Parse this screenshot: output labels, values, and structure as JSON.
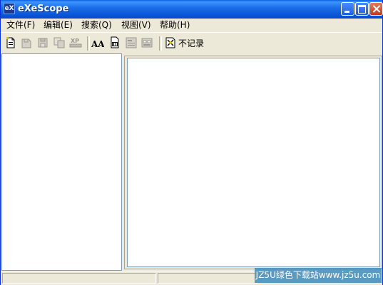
{
  "window": {
    "title": "eXeScope",
    "icon_text": "eX"
  },
  "menu": [
    {
      "label": "文件(F)"
    },
    {
      "label": "编辑(E)"
    },
    {
      "label": "搜索(Q)"
    },
    {
      "label": "视图(V)"
    },
    {
      "label": "帮助(H)"
    }
  ],
  "toolbar": {
    "no_record_label": "不记录",
    "aa_label": "AA",
    "xp_label": "XP"
  },
  "watermark": "JZ5U绿色下载站www.jz5u.com",
  "colors": {
    "titlebar": "#0a56d8",
    "chrome": "#ece9d8",
    "pane_border": "#7f9db9"
  }
}
